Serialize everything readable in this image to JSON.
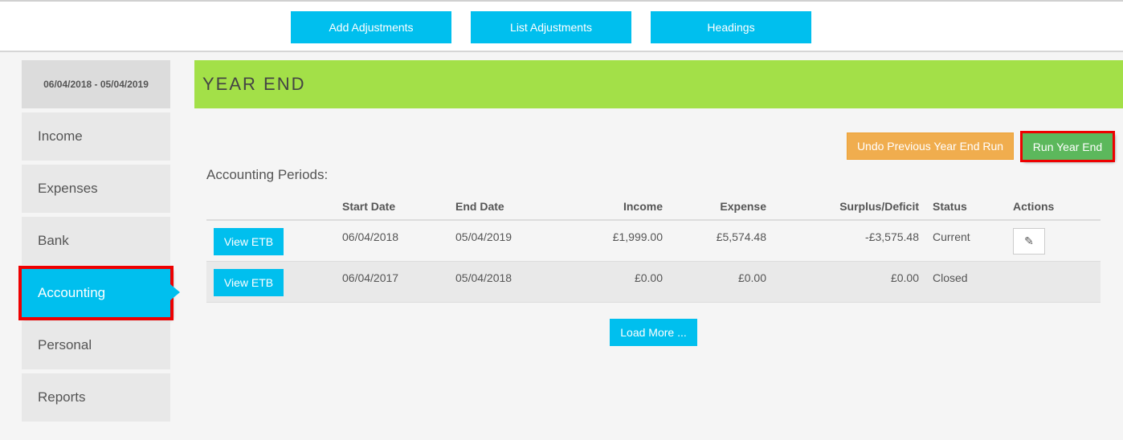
{
  "toolbar": {
    "add": "Add Adjustments",
    "list": "List Adjustments",
    "headings": "Headings"
  },
  "sidebar": {
    "period": "06/04/2018 - 05/04/2019",
    "items": [
      "Income",
      "Expenses",
      "Bank",
      "Accounting",
      "Personal",
      "Reports"
    ],
    "active": "Accounting"
  },
  "page_title": "YEAR END",
  "actions": {
    "undo": "Undo Previous Year End Run",
    "run": "Run Year End"
  },
  "section_title": "Accounting Periods:",
  "table": {
    "headers": [
      "",
      "Start Date",
      "End Date",
      "Income",
      "Expense",
      "Surplus/Deficit",
      "Status",
      "Actions"
    ],
    "rows": [
      {
        "button": "View ETB",
        "start": "06/04/2018",
        "end": "05/04/2019",
        "income": "£1,999.00",
        "expense": "£5,574.48",
        "surplus": "-£3,575.48",
        "status": "Current"
      },
      {
        "button": "View ETB",
        "start": "06/04/2017",
        "end": "05/04/2018",
        "income": "£0.00",
        "expense": "£0.00",
        "surplus": "£0.00",
        "status": "Closed"
      }
    ]
  },
  "load_more": "Load More ..."
}
